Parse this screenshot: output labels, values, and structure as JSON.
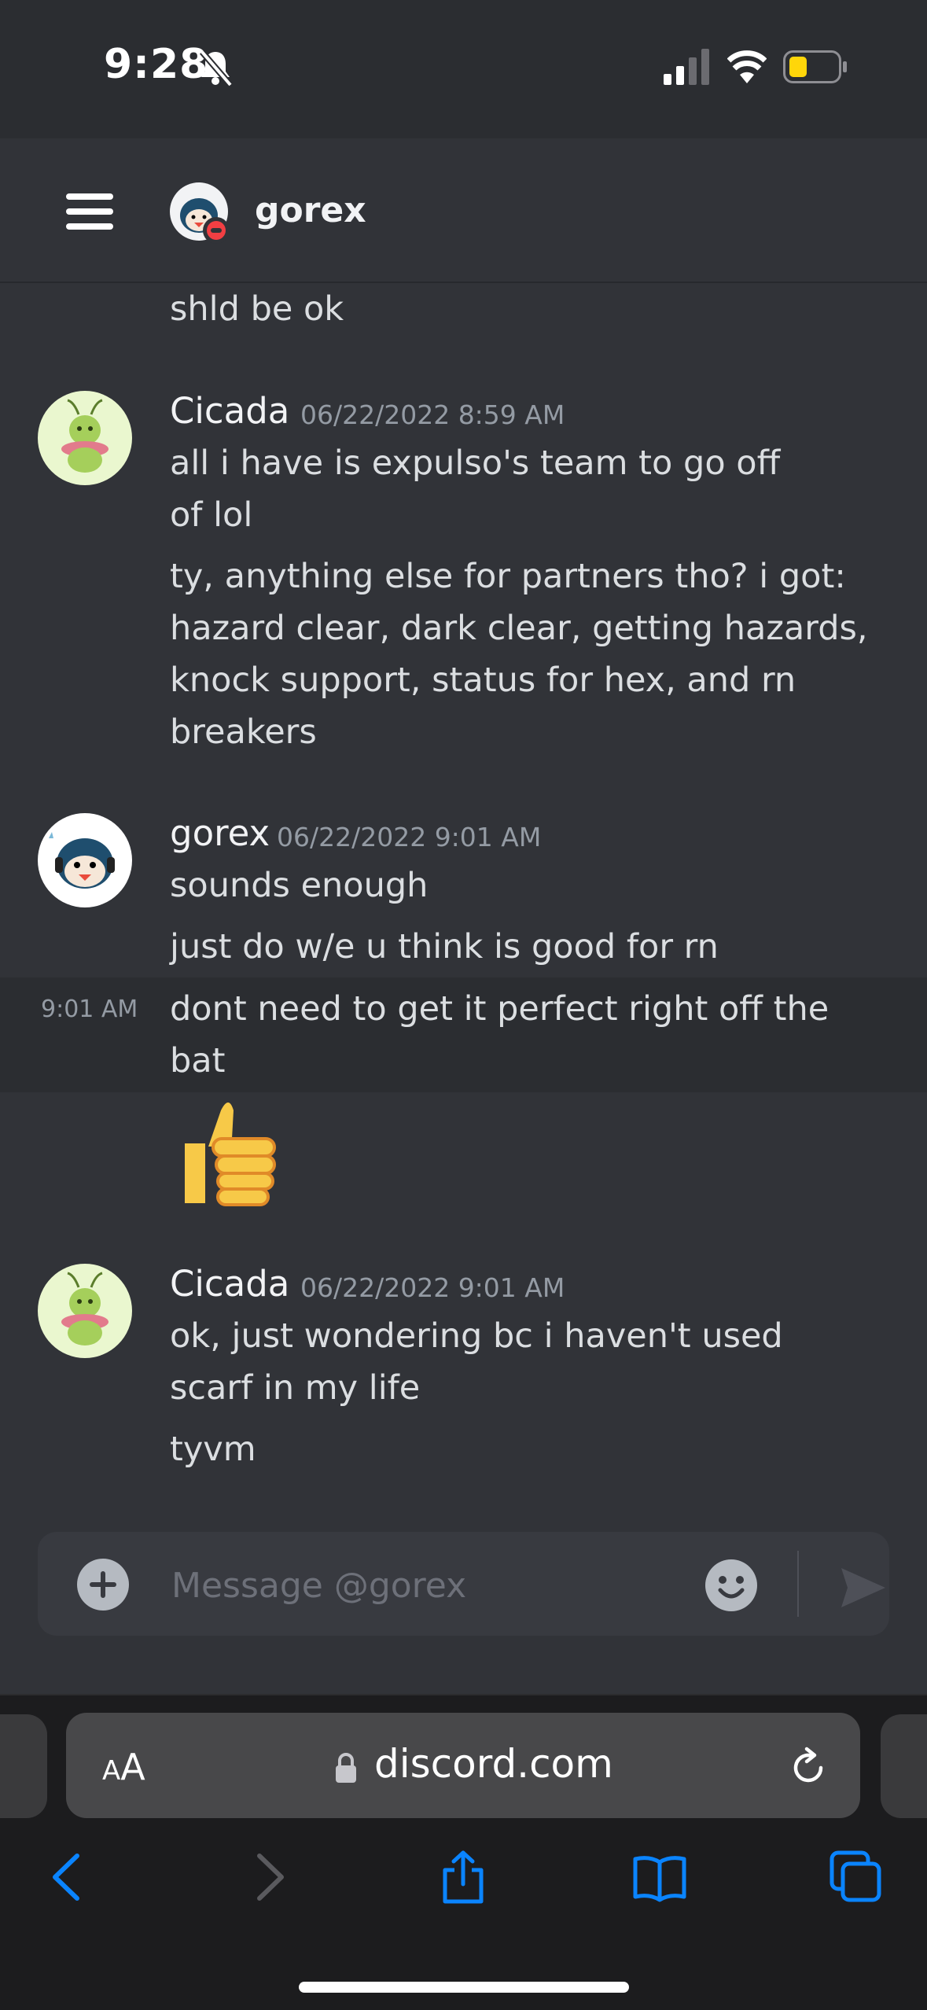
{
  "status_bar": {
    "time": "9:28"
  },
  "header": {
    "username": "gorex"
  },
  "messages": {
    "partial_line": "shld be ok",
    "group1": {
      "author": "Cicada",
      "timestamp": "06/22/2022 8:59 AM",
      "line1": "all i have is expulso's team to go off of lol",
      "line2": "ty, anything else for partners tho? i got: hazard clear, dark clear, getting hazards, knock support, status for hex, and rn breakers"
    },
    "group2": {
      "author": "gorex",
      "timestamp": "06/22/2022 9:01 AM",
      "line1": "sounds enough",
      "line2": "just do w/e u think is good for rn",
      "hover_time": "9:01 AM",
      "line3": "dont need to get it perfect right off the bat"
    },
    "group3": {
      "author": "Cicada",
      "timestamp": "06/22/2022 9:01 AM",
      "line1": "ok, just wondering bc i haven't used scarf in my life",
      "line2": "tyvm"
    }
  },
  "composer": {
    "placeholder": "Message @gorex"
  },
  "browser": {
    "aa_big": "A",
    "aa_small": "A",
    "domain": "discord.com"
  },
  "colors": {
    "background": "#313338",
    "dnd": "#f23f43",
    "ios_blue": "#0a84ff"
  }
}
